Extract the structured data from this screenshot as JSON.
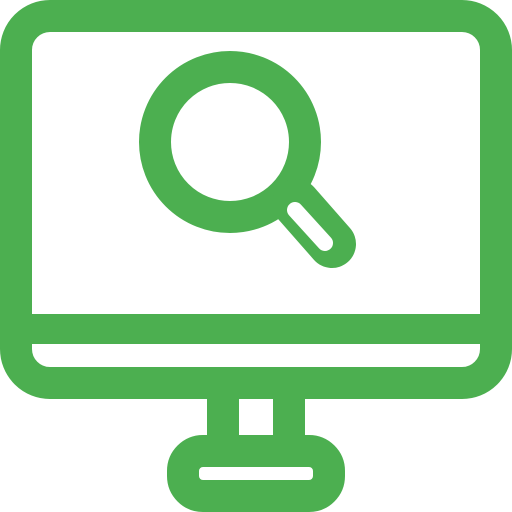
{
  "icon": {
    "name": "monitor-search-icon",
    "parts": [
      "monitor-icon",
      "magnifying-glass-icon"
    ],
    "color": "#4CAF50",
    "background": "#FFFFFF"
  }
}
